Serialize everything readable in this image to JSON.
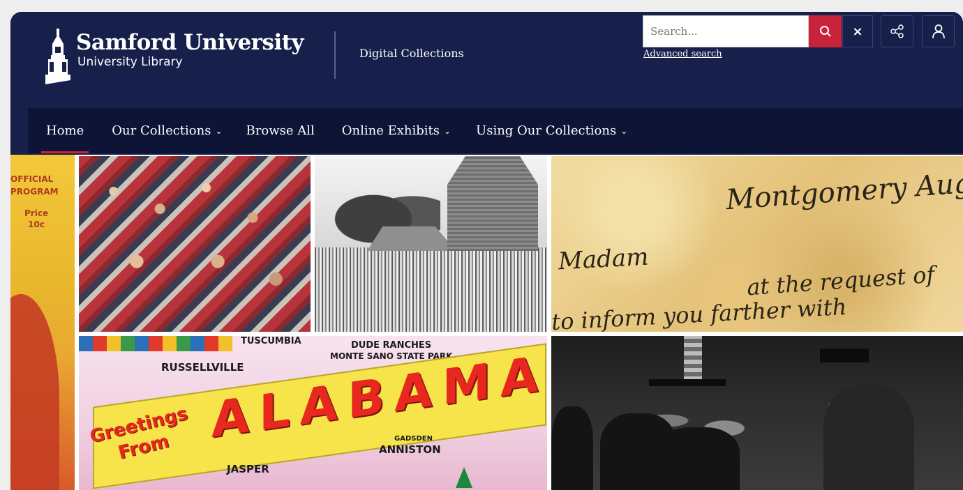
{
  "header": {
    "logo_name": "Samford University",
    "logo_sub": "University Library",
    "site_title": "Digital Collections",
    "search_placeholder": "Search...",
    "advanced_search": "Advanced search",
    "clear_label": "×"
  },
  "nav": {
    "items": [
      {
        "label": "Home",
        "active": true,
        "dropdown": false
      },
      {
        "label": "Our Collections",
        "active": false,
        "dropdown": true
      },
      {
        "label": "Browse All",
        "active": false,
        "dropdown": false
      },
      {
        "label": "Online Exhibits",
        "active": false,
        "dropdown": true
      },
      {
        "label": "Using Our Collections",
        "active": false,
        "dropdown": true
      }
    ]
  },
  "mosaic": {
    "program": {
      "line1": "OFFICIAL",
      "line2": "PROGRAM",
      "price": "Price",
      "amount": "10c"
    },
    "letter": {
      "line1": "Montgomery Aug",
      "line2": "Madam",
      "line3": "at the request of",
      "line4": "to inform you farther with"
    },
    "postcard": {
      "title": "ALABAMA",
      "greeting_1": "Greetings",
      "greeting_2": "From",
      "towns": [
        "TUSCUMBIA",
        "RUSSELLVILLE",
        "DUDE RANCHES",
        "MONTE SANO STATE PARK",
        "GADSDEN",
        "ANNISTON",
        "JASPER"
      ]
    }
  },
  "colors": {
    "navy": "#16204a",
    "nav_bg": "#0d1435",
    "accent_red": "#c8233a"
  },
  "icons": {
    "search": "search-icon",
    "close": "close-icon",
    "share": "share-icon",
    "user": "user-icon",
    "logo": "bell-tower-icon"
  }
}
